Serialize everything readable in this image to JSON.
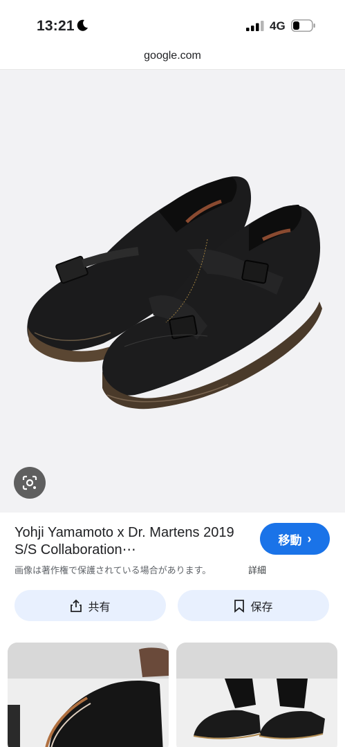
{
  "status_bar": {
    "time": "13:21",
    "network": "4G",
    "moon_icon": "moon-icon",
    "signal_icon": "signal-bars-icon",
    "battery_icon": "battery-icon"
  },
  "url_bar": {
    "domain": "google.com"
  },
  "result": {
    "title": "Yohji Yamamoto x Dr. Martens 2019 S/S Collaboration⋯",
    "visit_label": "移動",
    "copyright_notice": "画像は著作権で保護されている場合があります。",
    "details_label": "詳細",
    "share_label": "共有",
    "save_label": "保存"
  },
  "colors": {
    "accent": "#1a73e8",
    "pill_background": "#e8f0fe",
    "image_background": "#f2f2f4"
  }
}
